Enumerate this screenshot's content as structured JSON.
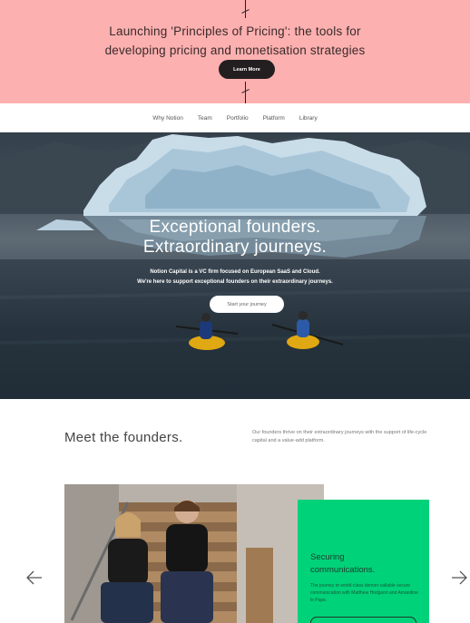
{
  "banner": {
    "line1": "Launching 'Principles of Pricing': the tools for",
    "line2": "developing pricing and monetisation strategies",
    "button_label": "Learn More"
  },
  "nav": {
    "items": [
      "Why Notion",
      "Team",
      "Portfolio",
      "Platform",
      "Library"
    ]
  },
  "hero": {
    "title_line1": "Exceptional founders.",
    "title_line2": "Extraordinary journeys.",
    "sub_line1": "Notion Capital is a VC firm focused on European SaaS and Cloud.",
    "sub_line2": "We're here to support exceptional founders on their extraordinary journeys.",
    "button_label": "Start your journey"
  },
  "founders": {
    "title": "Meet the founders.",
    "description": "Our founders thrive on their extraordinary journeys with the support of life-cycle capital and a value-add platform.",
    "card": {
      "title_line1": "Securing",
      "title_line2": "communications.",
      "text": "The journey to world-class demon-callable secure communication with Matthew Hodgson and Amandine le Pape."
    }
  },
  "icons": {
    "prev": "arrow-left-icon",
    "next": "arrow-right-icon"
  },
  "colors": {
    "banner_bg": "#fdb0b0",
    "card_bg": "#00d27a",
    "button_dark": "#231f20"
  }
}
